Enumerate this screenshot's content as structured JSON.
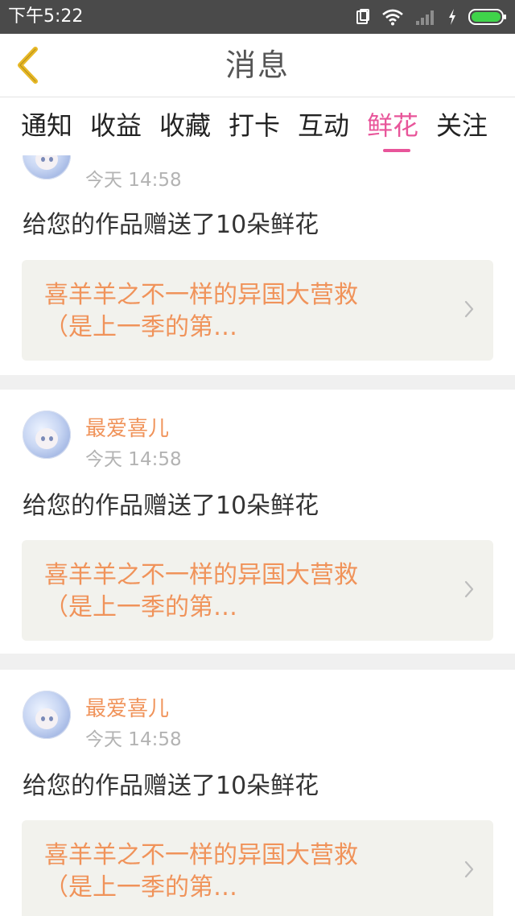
{
  "status_bar": {
    "time": "下午5:22",
    "icons": [
      "sim-icon",
      "wifi-icon",
      "signal-icon",
      "charging-icon",
      "battery-icon"
    ],
    "battery_color": "#3fd44a"
  },
  "header": {
    "title": "消息",
    "back_icon": "chevron-left-icon",
    "back_color": "#e7b826"
  },
  "tabs": [
    {
      "label": "通知"
    },
    {
      "label": "收益"
    },
    {
      "label": "收藏"
    },
    {
      "label": "打卡"
    },
    {
      "label": "互动"
    },
    {
      "label": "鲜花",
      "active": true
    },
    {
      "label": "关注"
    }
  ],
  "colors": {
    "accent_pink": "#e8559a",
    "accent_orange": "#f0935a"
  },
  "messages": [
    {
      "username": "",
      "time": "今天 14:58",
      "text": "给您的作品赠送了10朵鲜花",
      "work_line1": "喜羊羊之不一样的异国大营救",
      "work_line2": "（是上一季的第…"
    },
    {
      "username": "最爱喜儿",
      "time": "今天 14:58",
      "text": "给您的作品赠送了10朵鲜花",
      "work_line1": "喜羊羊之不一样的异国大营救",
      "work_line2": "（是上一季的第…"
    },
    {
      "username": "最爱喜儿",
      "time": "今天 14:58",
      "text": "给您的作品赠送了10朵鲜花",
      "work_line1": "喜羊羊之不一样的异国大营救",
      "work_line2": "（是上一季的第…"
    }
  ]
}
